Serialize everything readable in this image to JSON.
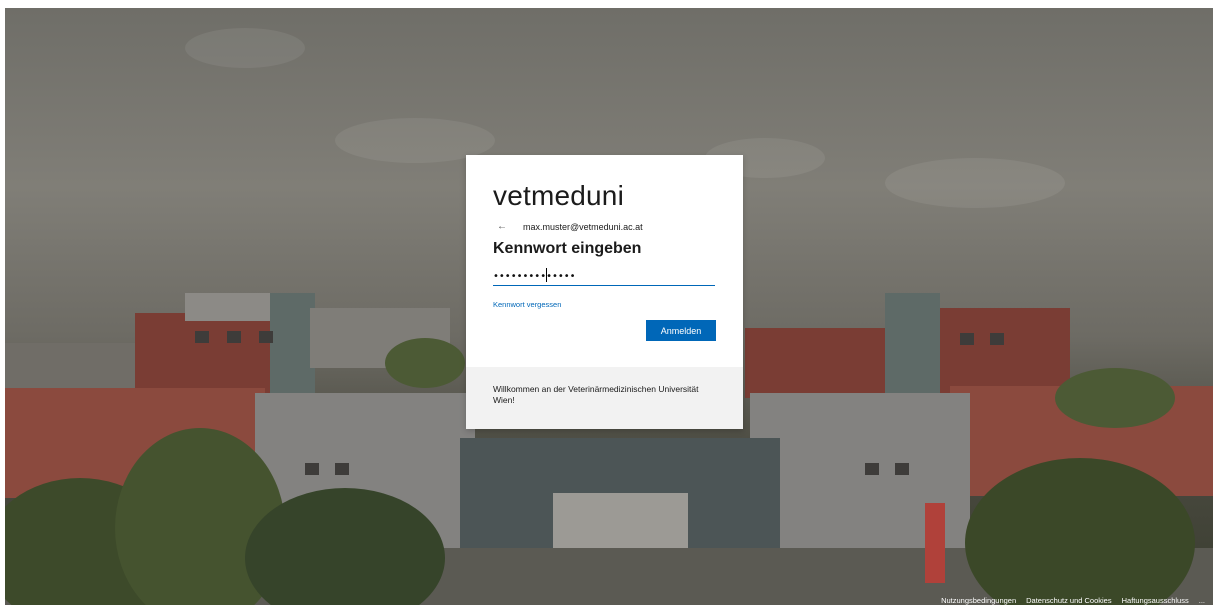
{
  "brand": {
    "logo_text": "vetmeduni"
  },
  "identity": {
    "back_icon": "←",
    "email": "max.muster@vetmeduni.ac.at"
  },
  "form": {
    "title": "Kennwort eingeben",
    "password_value": "••••••••••••••",
    "forgot_link": "Kennwort vergessen",
    "submit_label": "Anmelden"
  },
  "welcome": {
    "text": "Willkommen an der Veterinärmedizinischen Universität Wien!"
  },
  "footer": {
    "terms": "Nutzungsbedingungen",
    "privacy": "Datenschutz und Cookies",
    "disclaimer": "Haftungsausschluss",
    "more": "..."
  },
  "colors": {
    "accent": "#0067b8"
  }
}
